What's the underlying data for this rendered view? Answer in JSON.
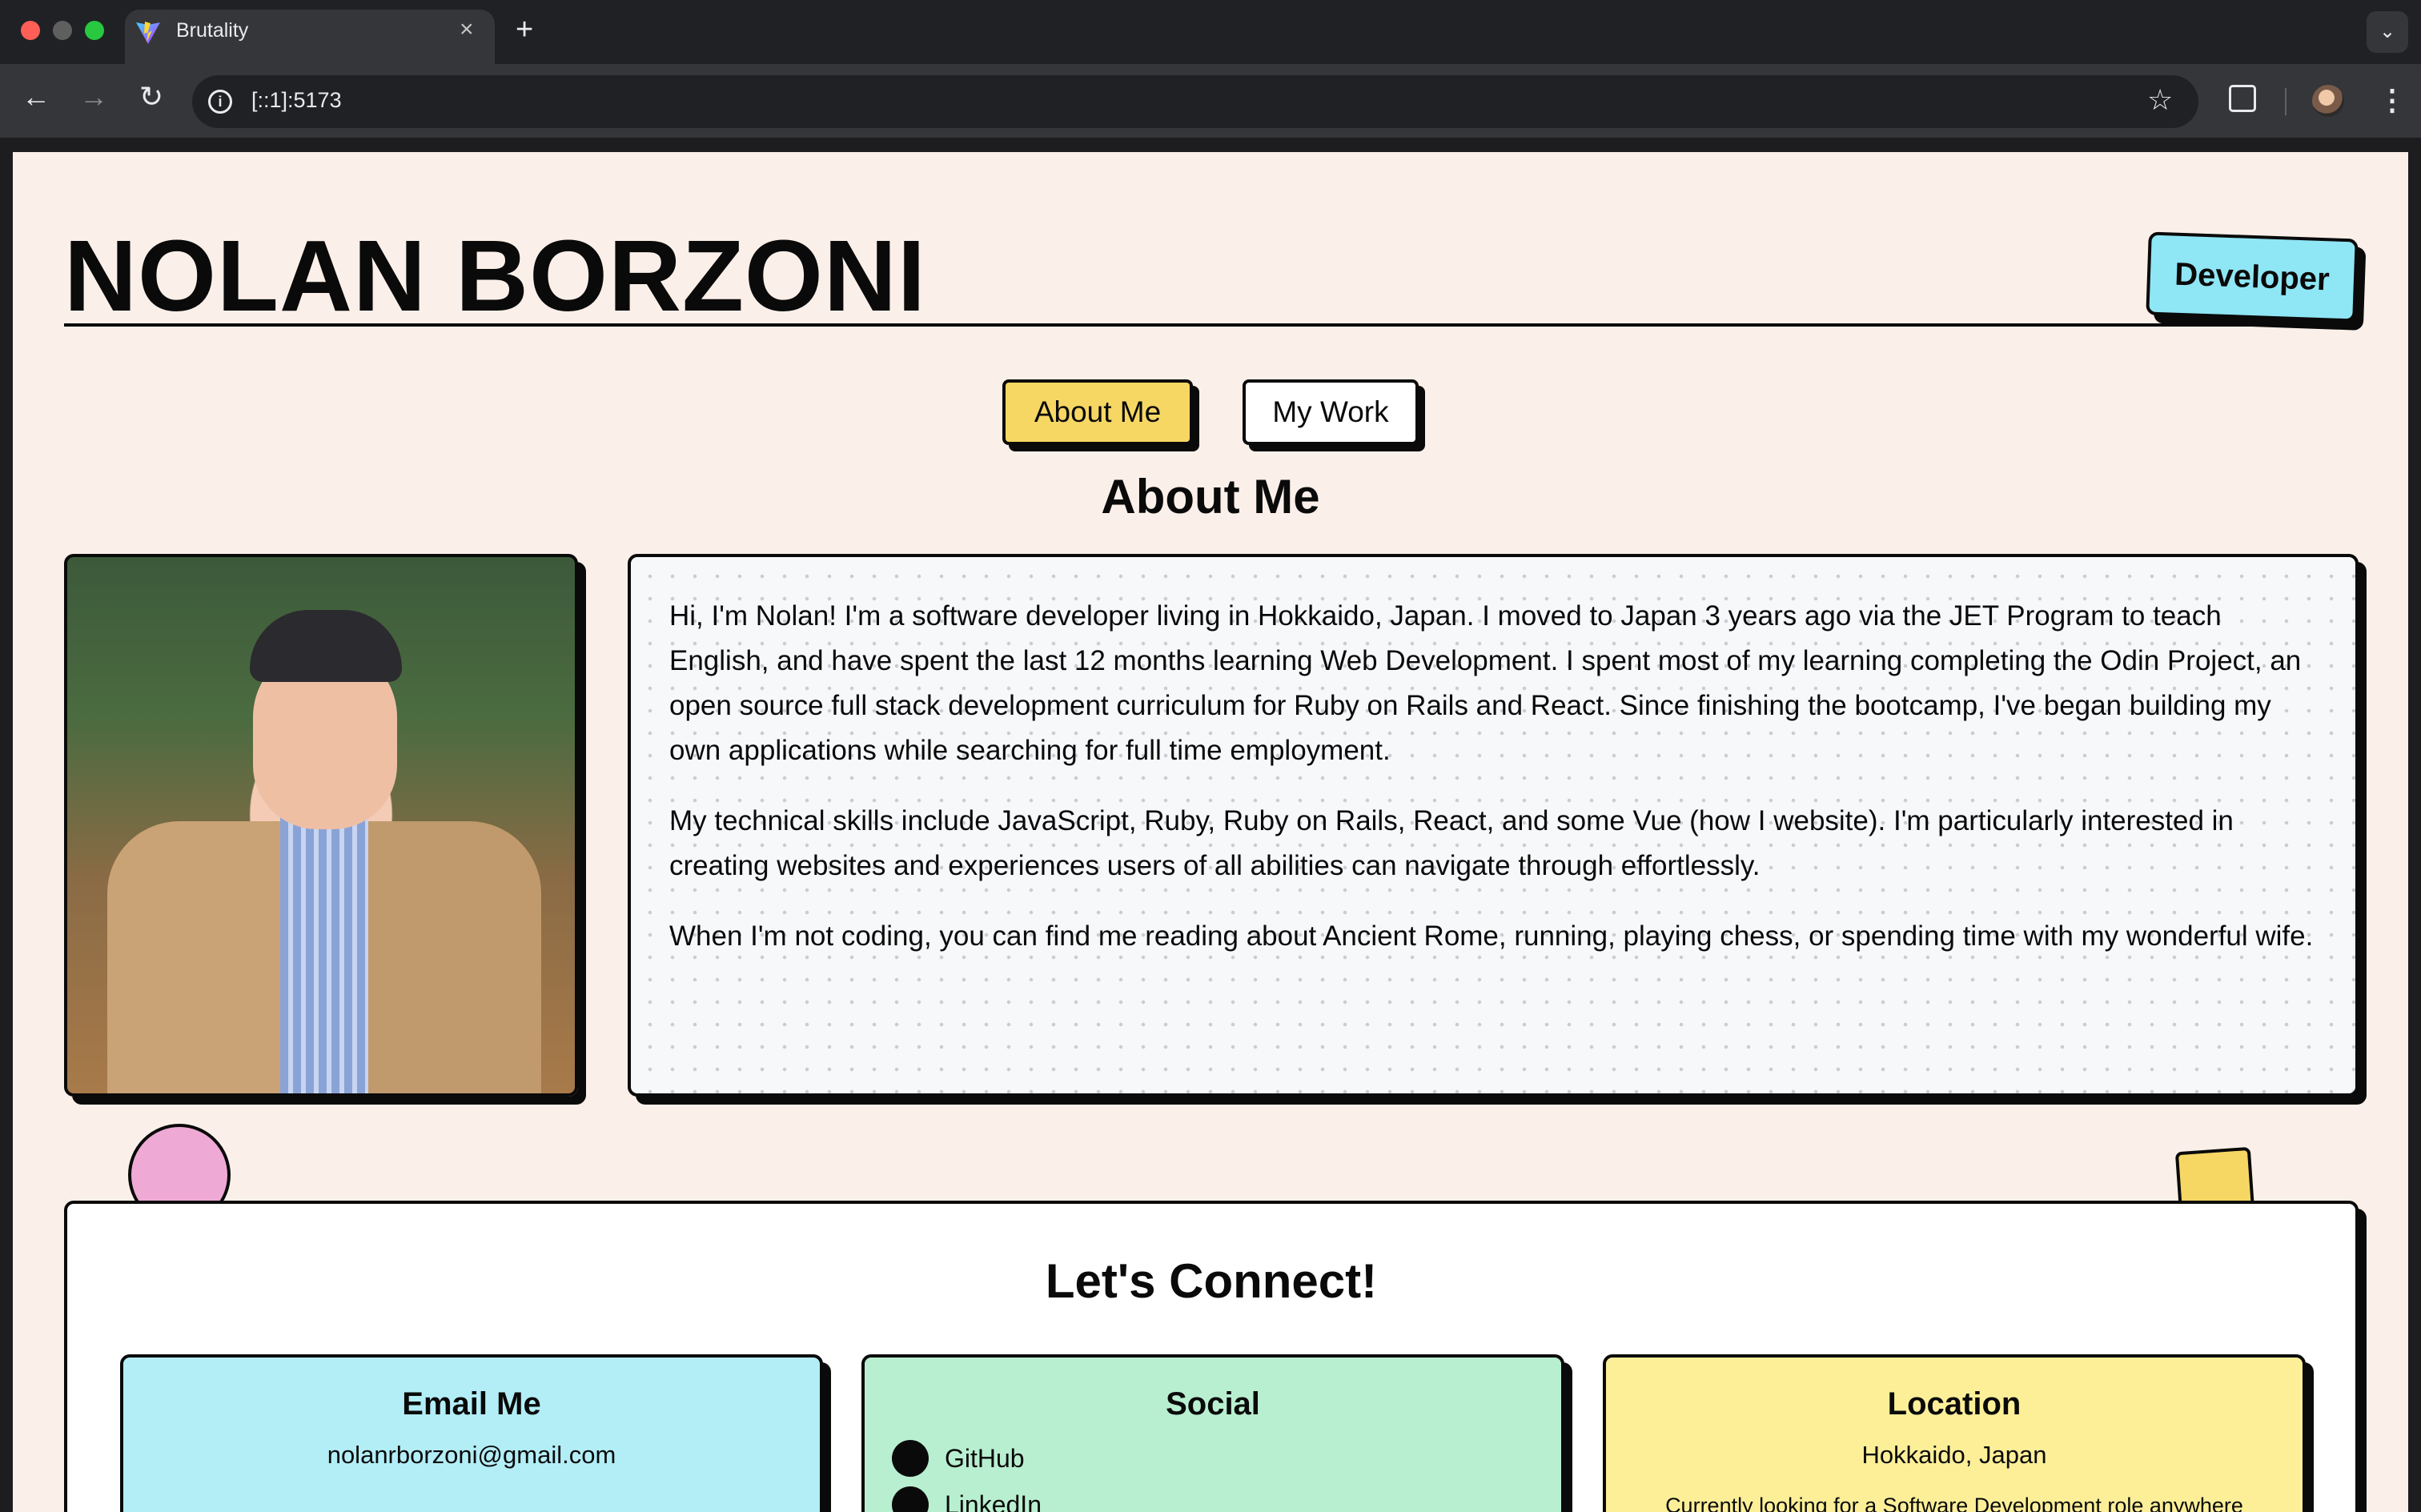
{
  "browser": {
    "tab_title": "Brutality",
    "url": "[::1]:5173",
    "close_glyph": "×",
    "new_tab_glyph": "+",
    "tab_menu_glyph": "⌄",
    "back_glyph": "←",
    "forward_glyph": "→",
    "reload_glyph": "↻",
    "star_glyph": "☆",
    "menu_glyph": "⋮",
    "info_glyph": "i",
    "traffic_colors": [
      "#ff5f57",
      "#5f5f5f",
      "#28c840"
    ]
  },
  "header": {
    "name": "NOLAN BORZONI",
    "badge": "Developer"
  },
  "nav": {
    "about_label": "About Me",
    "work_label": "My Work",
    "active": "About Me"
  },
  "about": {
    "title": "About Me",
    "paragraphs": [
      "Hi, I'm Nolan! I'm a software developer living in Hokkaido, Japan. I moved to Japan 3 years ago via the JET Program to teach English, and have spent the last 12 months learning Web Development. I spent most of my learning completing the Odin Project, an open source full stack development curriculum for Ruby on Rails and React. Since finishing the bootcamp, I've began building my own applications while searching for full time employment.",
      "My technical skills include JavaScript, Ruby, Ruby on Rails, React, and some Vue (how I website). I'm particularly interested in creating websites and experiences users of all abilities can navigate through effortlessly.",
      "When I'm not coding, you can find me reading about Ancient Rome, running, playing chess, or spending time with my wonderful wife."
    ]
  },
  "connect": {
    "title": "Let's Connect!",
    "email": {
      "title": "Email Me",
      "address": "nolanrborzoni@gmail.com"
    },
    "social": {
      "title": "Social",
      "links": [
        "GitHub",
        "LinkedIn"
      ]
    },
    "location": {
      "title": "Location",
      "place": "Hokkaido, Japan",
      "note": "Currently looking for a Software Development role anywhere"
    }
  },
  "colors": {
    "background": "#fbf0e9",
    "badge": "#8fe6f5",
    "active_pill": "#f7d764",
    "email_card": "#b3eef7",
    "social_card": "#b8efd0",
    "location_card": "#fcef98",
    "circle_deco": "#eeaad5"
  }
}
